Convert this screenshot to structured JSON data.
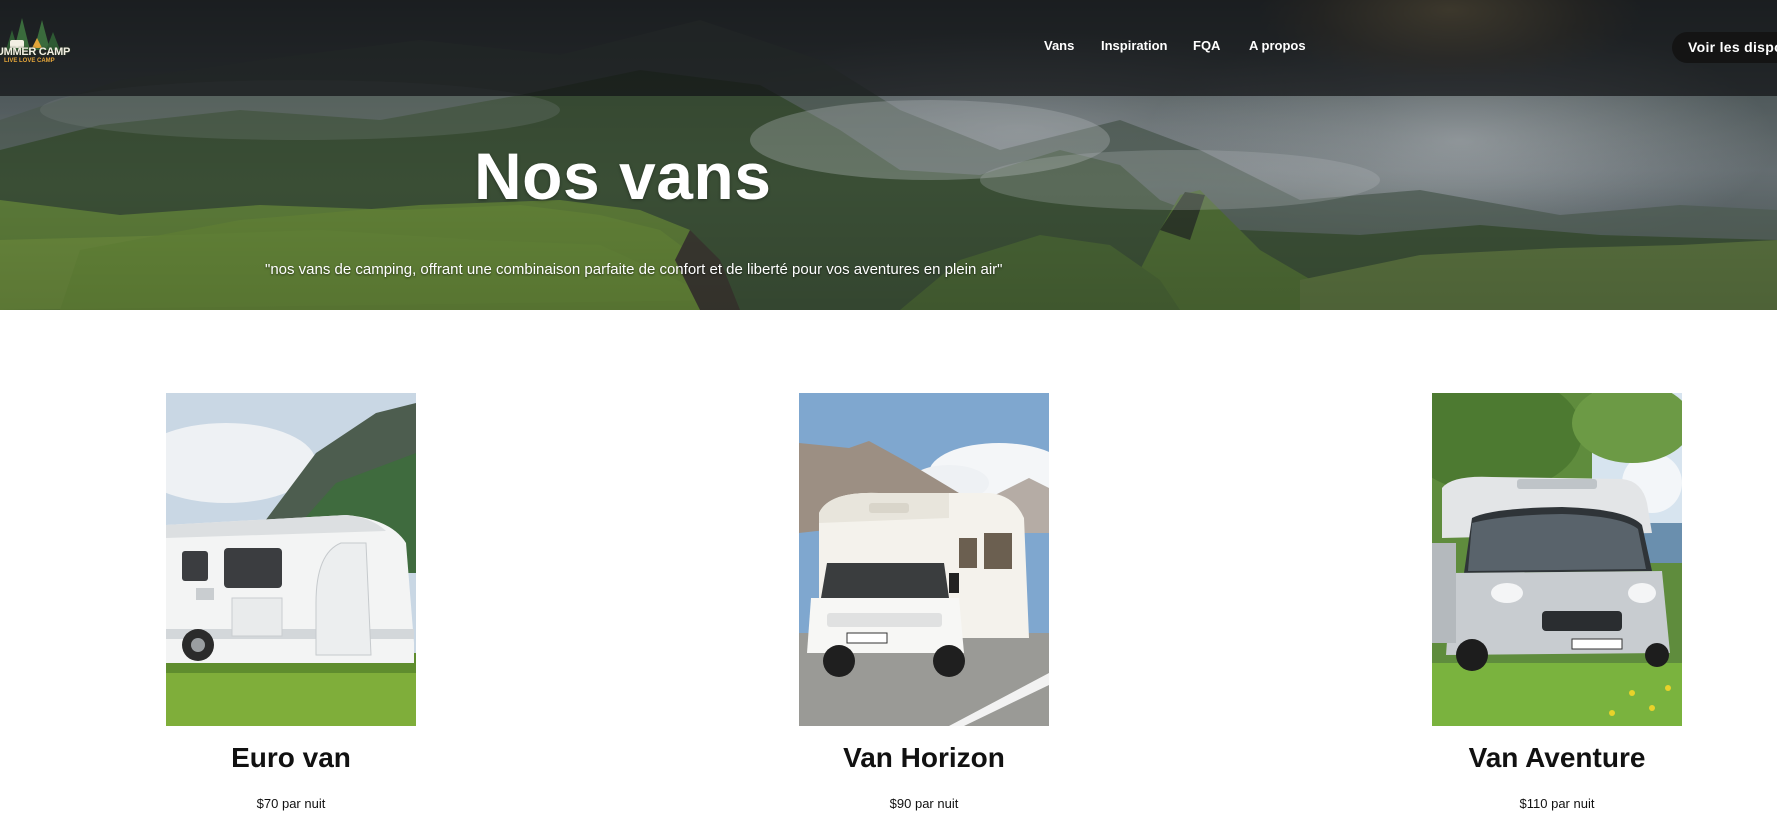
{
  "brand": {
    "logo_text": "UMMER CAMP",
    "logo_tagline": "LIVE LOVE CAMP"
  },
  "nav": {
    "items": [
      {
        "label": "Vans"
      },
      {
        "label": "Inspiration"
      },
      {
        "label": "FQA"
      },
      {
        "label": "A propos"
      }
    ],
    "cta_label": "Voir les dispo"
  },
  "hero": {
    "title": "Nos vans",
    "subtitle": "\"nos vans de camping, offrant une combinaison parfaite de confort et de liberté pour vos aventures en plein air\""
  },
  "vans": [
    {
      "name": "Euro van",
      "price": "$70 par nuit"
    },
    {
      "name": "Van Horizon",
      "price": "$90 par nuit"
    },
    {
      "name": "Van Aventure",
      "price": "$110 par nuit"
    }
  ],
  "colors": {
    "header_bg": "#141618",
    "cta_bg": "#141414",
    "text_dark": "#111111",
    "text_light": "#ffffff",
    "logo_orange": "#e2a53a"
  }
}
